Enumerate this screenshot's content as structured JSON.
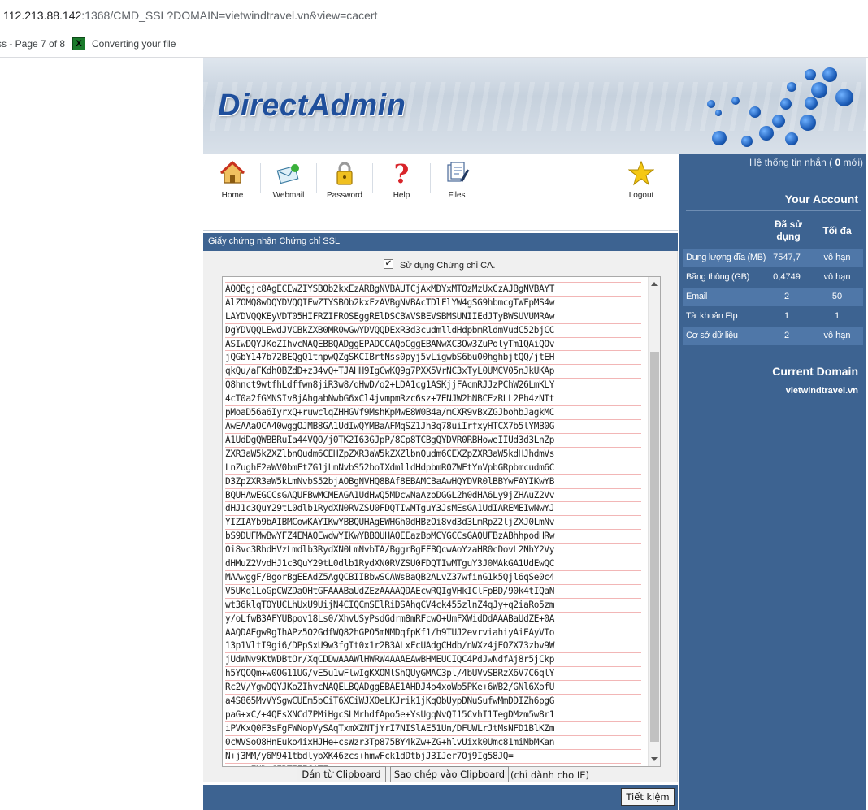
{
  "browser": {
    "url_host": "112.213.88.142",
    "url_rest": ":1368/CMD_SSL?DOMAIN=vietwindtravel.vn&view=cacert",
    "bookmark_1": "ss - Page 7 of 8",
    "bookmark_2": "Converting your file"
  },
  "header": {
    "logo": "DirectAdmin"
  },
  "toolbar": {
    "items": [
      {
        "label": "Home",
        "icon": "home-icon"
      },
      {
        "label": "Webmail",
        "icon": "mail-icon"
      },
      {
        "label": "Password",
        "icon": "lock-icon"
      },
      {
        "label": "Help",
        "icon": "help-icon"
      },
      {
        "label": "Files",
        "icon": "files-icon"
      },
      {
        "label": "Logout",
        "icon": "star-icon"
      }
    ]
  },
  "sidebar": {
    "messages_prefix": "Hệ thống tin nhắn (",
    "messages_count": "0",
    "messages_suffix": " mới)",
    "your_account": "Your Account",
    "col_used": "Đã sử dụng",
    "col_max": "Tối đa",
    "rows": [
      {
        "name": "Dung lượng đĩa (MB)",
        "used": "7547,7",
        "max": "vô hạn"
      },
      {
        "name": "Băng thông (GB)",
        "used": "0,4749",
        "max": "vô hạn"
      },
      {
        "name": "Email",
        "used": "2",
        "max": "50"
      },
      {
        "name": "Tài khoản Ftp",
        "used": "1",
        "max": "1"
      },
      {
        "name": "Cơ sở dữ liệu",
        "used": "2",
        "max": "vô hạn"
      }
    ],
    "current_domain": "Current Domain",
    "domain": "vietwindtravel.vn"
  },
  "section": {
    "title": "Giấy chứng nhận Chứng chỉ SSL"
  },
  "form": {
    "use_ca_label": "Sử dụng Chứng chỉ CA.",
    "use_ca_checked": true,
    "cert_lines": [
      "AQQBgjc8AgECEwZIYSBOb2kxEzARBgNVBAUTCjAxMDYxMTQzMzUxCzAJBgNVBAYT",
      "AlZOMQ8wDQYDVQQIEwZIYSBOb2kxFzAVBgNVBAcTDlFlYW4gSG9hbmcgTWFpMS4w",
      "LAYDVQQKEyVDT05HIFRZIFROSEggRElDSCBWVSBEVSBMSUNIIEdJTyBWSUVUMRAw",
      "DgYDVQQLEwdJVCBkZXB0MR0wGwYDVQQDExR3d3cudmlldHdpbmRldmVudC52bjCC",
      "ASIwDQYJKoZIhvcNAQEBBQADggEPADCCAQoCggEBANwXC3Ow3ZuPolyTm1QAiQOv",
      "jQGbY147b72BEQgQ1tnpwQZgSKCIBrtNss0pyj5vLigwbS6bu00hghbjtQQ/jtEH",
      "qkQu/aFKdhOBZdD+z34vQ+TJAHH9IgCwKQ9g7PXX5VrNC3xTyL0UMCV05nJkUKAp",
      "Q8hnct9wtfhLdffwn8jiR3w8/qHwD/o2+LDA1cg1ASKjjFAcmRJJzPChW26LmKLY",
      "4cT0a2fGMNSIv8jAhgabNwbG6xCl4jvmpmRzc6sz+7ENJW2hNBCEzRLL2Ph4zNTt",
      "pMoaD56a6IyrxQ+ruwclqZHHGVf9MshKpMwE8W0B4a/mCXR9vBxZGJbohbJagkMC",
      "AwEAAaOCA40wggOJMB8GA1UdIwQYMBaAFMqSZ1Jh3q78uiIrfxyHTCX7b5lYMB0G",
      "A1UdDgQWBBRuIa44VQO/j0TK2I63GJpP/8Cp8TCBgQYDVR0RBHoweIIUd3d3LnZp",
      "ZXR3aW5kZXZlbnQudm6CEHZpZXR3aW5kZXZlbnQudm6CEXZpZXR3aW5kdHJhdmVs",
      "LnZughF2aWV0bmFtZG1jLmNvbS52boIXdmlldHdpbmR0ZWFtYnVpbGRpbmcudm6C",
      "D3ZpZXR3aW5kLmNvbS52bjAOBgNVHQ8BAf8EBAMCBaAwHQYDVR0lBBYwFAYIKwYB",
      "BQUHAwEGCCsGAQUFBwMCMEAGA1UdHwQ5MDcwNaAzoDGGL2h0dHA6Ly9jZHAuZ2Vv",
      "dHJ1c3QuY29tL0dlb1RydXN0RVZSU0FDQTIwMTguY3JsMEsGA1UdIAREMEIwNwYJ",
      "YIZIAYb9bAIBMCowKAYIKwYBBQUHAgEWHGh0dHBzOi8vd3d3LmRpZ2ljZXJ0LmNv",
      "bS9DUFMwBwYFZ4EMAQEwdwYIKwYBBQUHAQEEazBpMCYGCCsGAQUFBzABhhpodHRw",
      "Oi8vc3RhdHVzLmdlb3RydXN0LmNvbTA/BggrBgEFBQcwAoYzaHR0cDovL2NhY2Vy",
      "dHMuZ2VvdHJ1c3QuY29tL0dlb1RydXN0RVZSU0FDQTIwMTguY3J0MAkGA1UdEwQC",
      "MAAwggF/BgorBgEEAdZ5AgQCBIIBbwSCAWsBaQB2ALvZ37wfinG1k5Qjl6qSe0c4",
      "V5UKq1LoGpCWZDaOHtGFAAABaUdZEzAAAAQDAEcwRQIgVHkIClFpBD/90k4tIQaN",
      "wt36klqTOYUCLhUxU9UijN4CIQCmSElRiDSAhqCV4ck455zlnZ4qJy+q2iaRo5zm",
      "y/oLfwB3AFYUBpov18Ls0/XhvUSyPsdGdrm8mRFcwO+UmFXWidDdAAABaUdZE+0A",
      "AAQDAEgwRgIhAPz5O2GdfWQ82hGPO5mNMDqfpKf1/h9TUJ2evrviahiyAiEAyVIo",
      "13p1VltI9gi6/DPpSxU9w3fgIt0x1r2B3ALxFcUAdgCHdb/nWXz4jEOZX73zbv9W",
      "jUdWNv9KtWDBtOr/XqCDDwAAAWlHWRW4AAAEAwBHMEUCIQC4PdJwNdfAj8r5jCkp",
      "h5YQOQm+w0OG11UG/vE5u1wFlwIgKXOMlShQUyGMAC3pl/4bUVvSBRzX6V7C6qlY",
      "Rc2V/YgwDQYJKoZIhvcNAQELBQADggEBAE1AHDJ4o4xoWb5PKe+6WB2/GNl6XofU",
      "a4S865MvVYSgwCUEm5bCiT6XCiWJXOeLKJrik1jKqQbUypDNuSufwMmDDIZh6pgG",
      "paG+xC/+4QEsXNCd7PMiHgcSLMrhdfApo5e+YsUgqNvQI15CvhI1TegDMzm5w8r1",
      "iPVKxQ0F3sFgFWNopVySAqTxmXZNTjYrI7NISlAE51Un/DFUWLrJtMsNFD1BlKZm",
      "0cWVSoO8HnEuko4ixHJHe+csWzr3Tp875BY4kZw+ZG+hlvUixk0Umc81miMbMKan",
      "N+j3MM/y6M941tbdlybXK46zcs+hmwFck1dDtbjJ3IJer7Oj9Ig58JQ=",
      "-----END CERTIFICATE-----"
    ],
    "btn_paste": "Dán từ Clipboard",
    "btn_copy": "Sao chép vào Clipboard",
    "ie_note": "(chỉ dành cho IE)",
    "btn_save": "Tiết kiệm"
  }
}
